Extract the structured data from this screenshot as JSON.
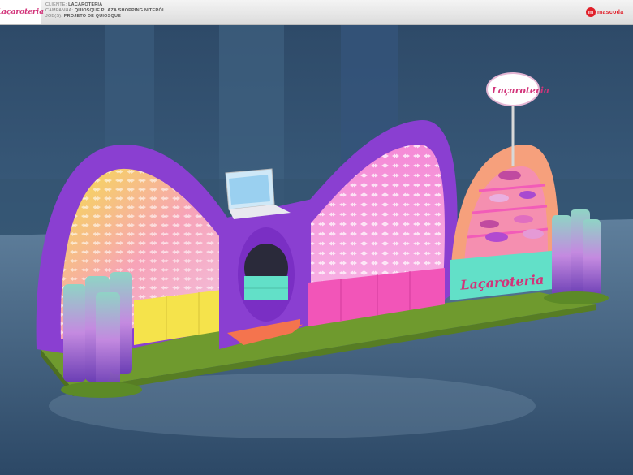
{
  "header": {
    "logo": "Laçaroteria",
    "cliente_label": "CLIENTE:",
    "cliente": "LAÇAROTERIA",
    "campanha_label": "CAMPANHA:",
    "campanha": "QUIOSQUE PLAZA SHOPPING NITERÓI",
    "job_label": "JOB(S):",
    "job": "PROJETO DE QUIOSQUE",
    "brand": "mascoda"
  },
  "scene": {
    "sign_text": "Laçaroteria",
    "counter_text": "Laçaroteria"
  },
  "colors": {
    "purple": "#8a3fd1",
    "pink": "#f25cb8",
    "coral": "#f6a07c",
    "mint": "#62e0c8",
    "yellow": "#f5e34b",
    "grass": "#6f9a2e"
  }
}
